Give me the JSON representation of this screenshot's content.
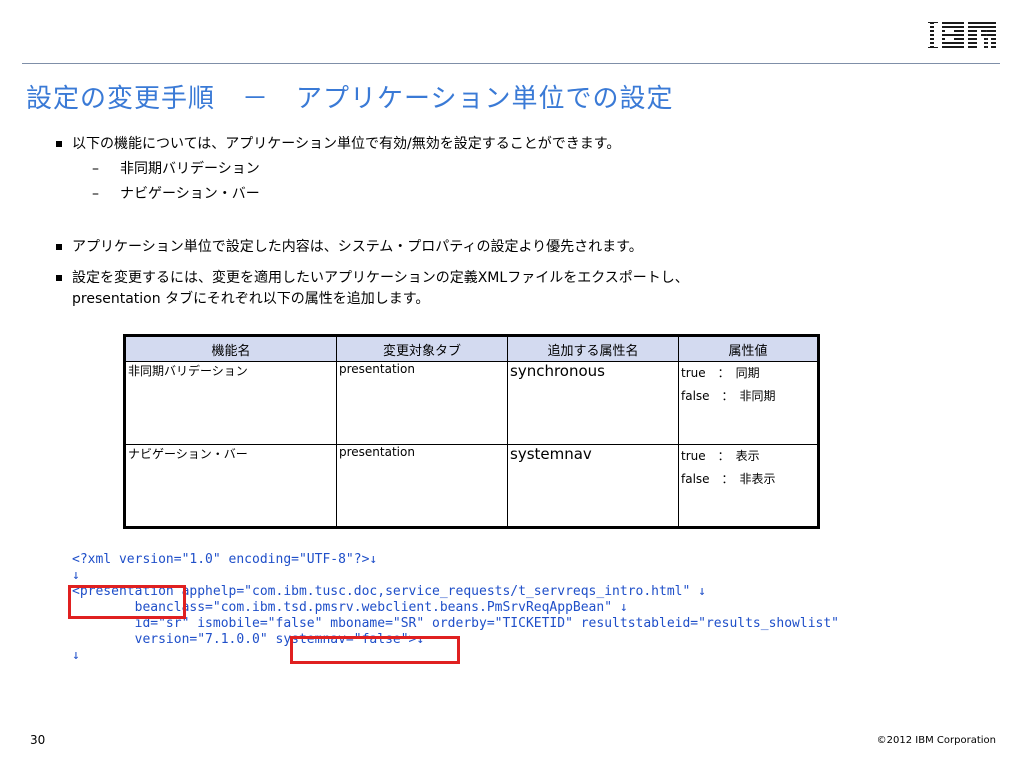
{
  "brand": {
    "logo_text": "IBM",
    "accent_color": "#3a7ad6"
  },
  "title": "設定の変更手順　－　アプリケーション単位での設定",
  "bullets": {
    "b1": "以下の機能については、アプリケーション単位で有効/無効を設定することができます。",
    "b1_sub": [
      "非同期バリデーション",
      "ナビゲーション・バー"
    ],
    "b2": "アプリケーション単位で設定した内容は、システム・プロパティの設定より優先されます。",
    "b3_line1": "設定を変更するには、変更を適用したいアプリケーションの定義XMLファイルをエクスポートし、",
    "b3_line2": "presentation タブにそれぞれ以下の属性を追加します。"
  },
  "table": {
    "headers": [
      "機能名",
      "変更対象タブ",
      "追加する属性名",
      "属性値"
    ],
    "rows": [
      {
        "feature": "非同期バリデーション",
        "tab": "presentation",
        "attribute": "synchronous",
        "values": [
          "true　：　同期",
          "false　：　非同期"
        ]
      },
      {
        "feature": "ナビゲーション・バー",
        "tab": "presentation",
        "attribute": "systemnav",
        "values": [
          "true　：　表示",
          "false　：　非表示"
        ]
      }
    ]
  },
  "code": {
    "lines": [
      "<?xml version=\"1.0\" encoding=\"UTF-8\"?>↓",
      "↓",
      "<presentation apphelp=\"com.ibm.tusc.doc,service_requests/t_servreqs_intro.html\" ↓",
      "        beanclass=\"com.ibm.tsd.pmsrv.webclient.beans.PmSrvReqAppBean\" ↓",
      "        id=\"sr\" ismobile=\"false\" mboname=\"SR\" orderby=\"TICKETID\" resultstableid=\"results_showlist\"",
      "        version=\"7.1.0.0\" systemnav=\"false\">↓",
      "↓"
    ],
    "highlight_color": "#e02020"
  },
  "footer": {
    "page_number": "30",
    "copyright": "©2012 IBM Corporation"
  }
}
